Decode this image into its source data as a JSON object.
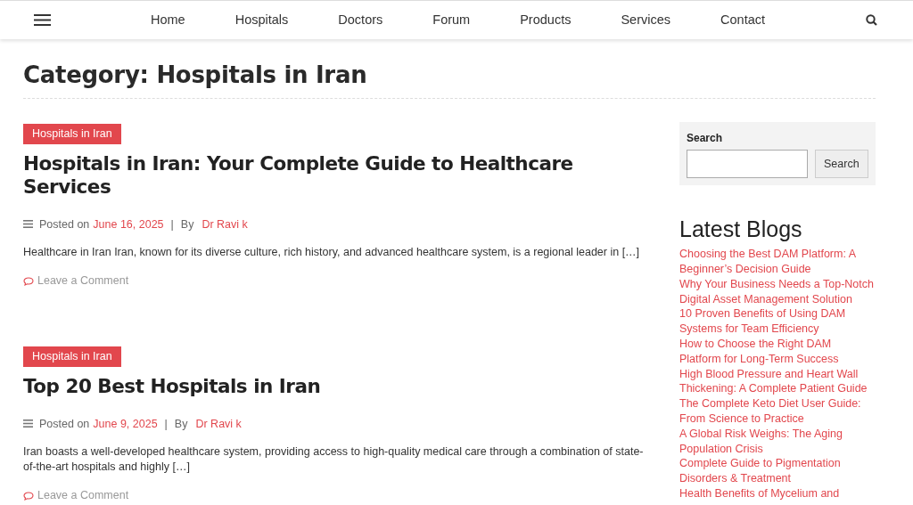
{
  "nav": {
    "items": [
      "Home",
      "Hospitals",
      "Doctors",
      "Forum",
      "Products",
      "Services",
      "Contact"
    ]
  },
  "page_title": "Category: Hospitals in Iran",
  "posts": [
    {
      "category": "Hospitals in Iran",
      "title": "Hospitals in Iran: Your Complete Guide to Healthcare Services",
      "posted_label": "Posted on",
      "date": "June 16, 2025",
      "separator": "|",
      "by_label": "By",
      "author": "Dr Ravi k",
      "excerpt": "Healthcare in Iran Iran, known for its diverse culture, rich history, and advanced healthcare system, is a regional leader in […]",
      "comment_link": "Leave a Comment"
    },
    {
      "category": "Hospitals in Iran",
      "title": "Top 20 Best Hospitals in Iran",
      "posted_label": "Posted on",
      "date": "June 9, 2025",
      "separator": "|",
      "by_label": "By",
      "author": "Dr Ravi k",
      "excerpt": "Iran boasts a well-developed healthcare system, providing access to high-quality medical care through a combination of state-of-the-art hospitals and highly […]",
      "comment_link": "Leave a Comment"
    }
  ],
  "sidebar": {
    "search": {
      "label": "Search",
      "button": "Search"
    },
    "latest_blogs": {
      "title": "Latest Blogs",
      "items": [
        "Choosing the Best DAM Platform: A Beginner’s Decision Guide",
        "Why Your Business Needs a Top-Notch Digital Asset Management Solution",
        "10 Proven Benefits of Using DAM Systems for Team Efficiency",
        "How to Choose the Right DAM Platform for Long-Term Success",
        "High Blood Pressure and Heart Wall Thickening: A Complete Patient Guide",
        "The Complete Keto Diet User Guide: From Science to Practice",
        "A Global Risk Weighs: The Aging Population Crisis",
        "Complete Guide to Pigmentation Disorders & Treatment",
        "Health Benefits of Mycelium and"
      ]
    }
  }
}
